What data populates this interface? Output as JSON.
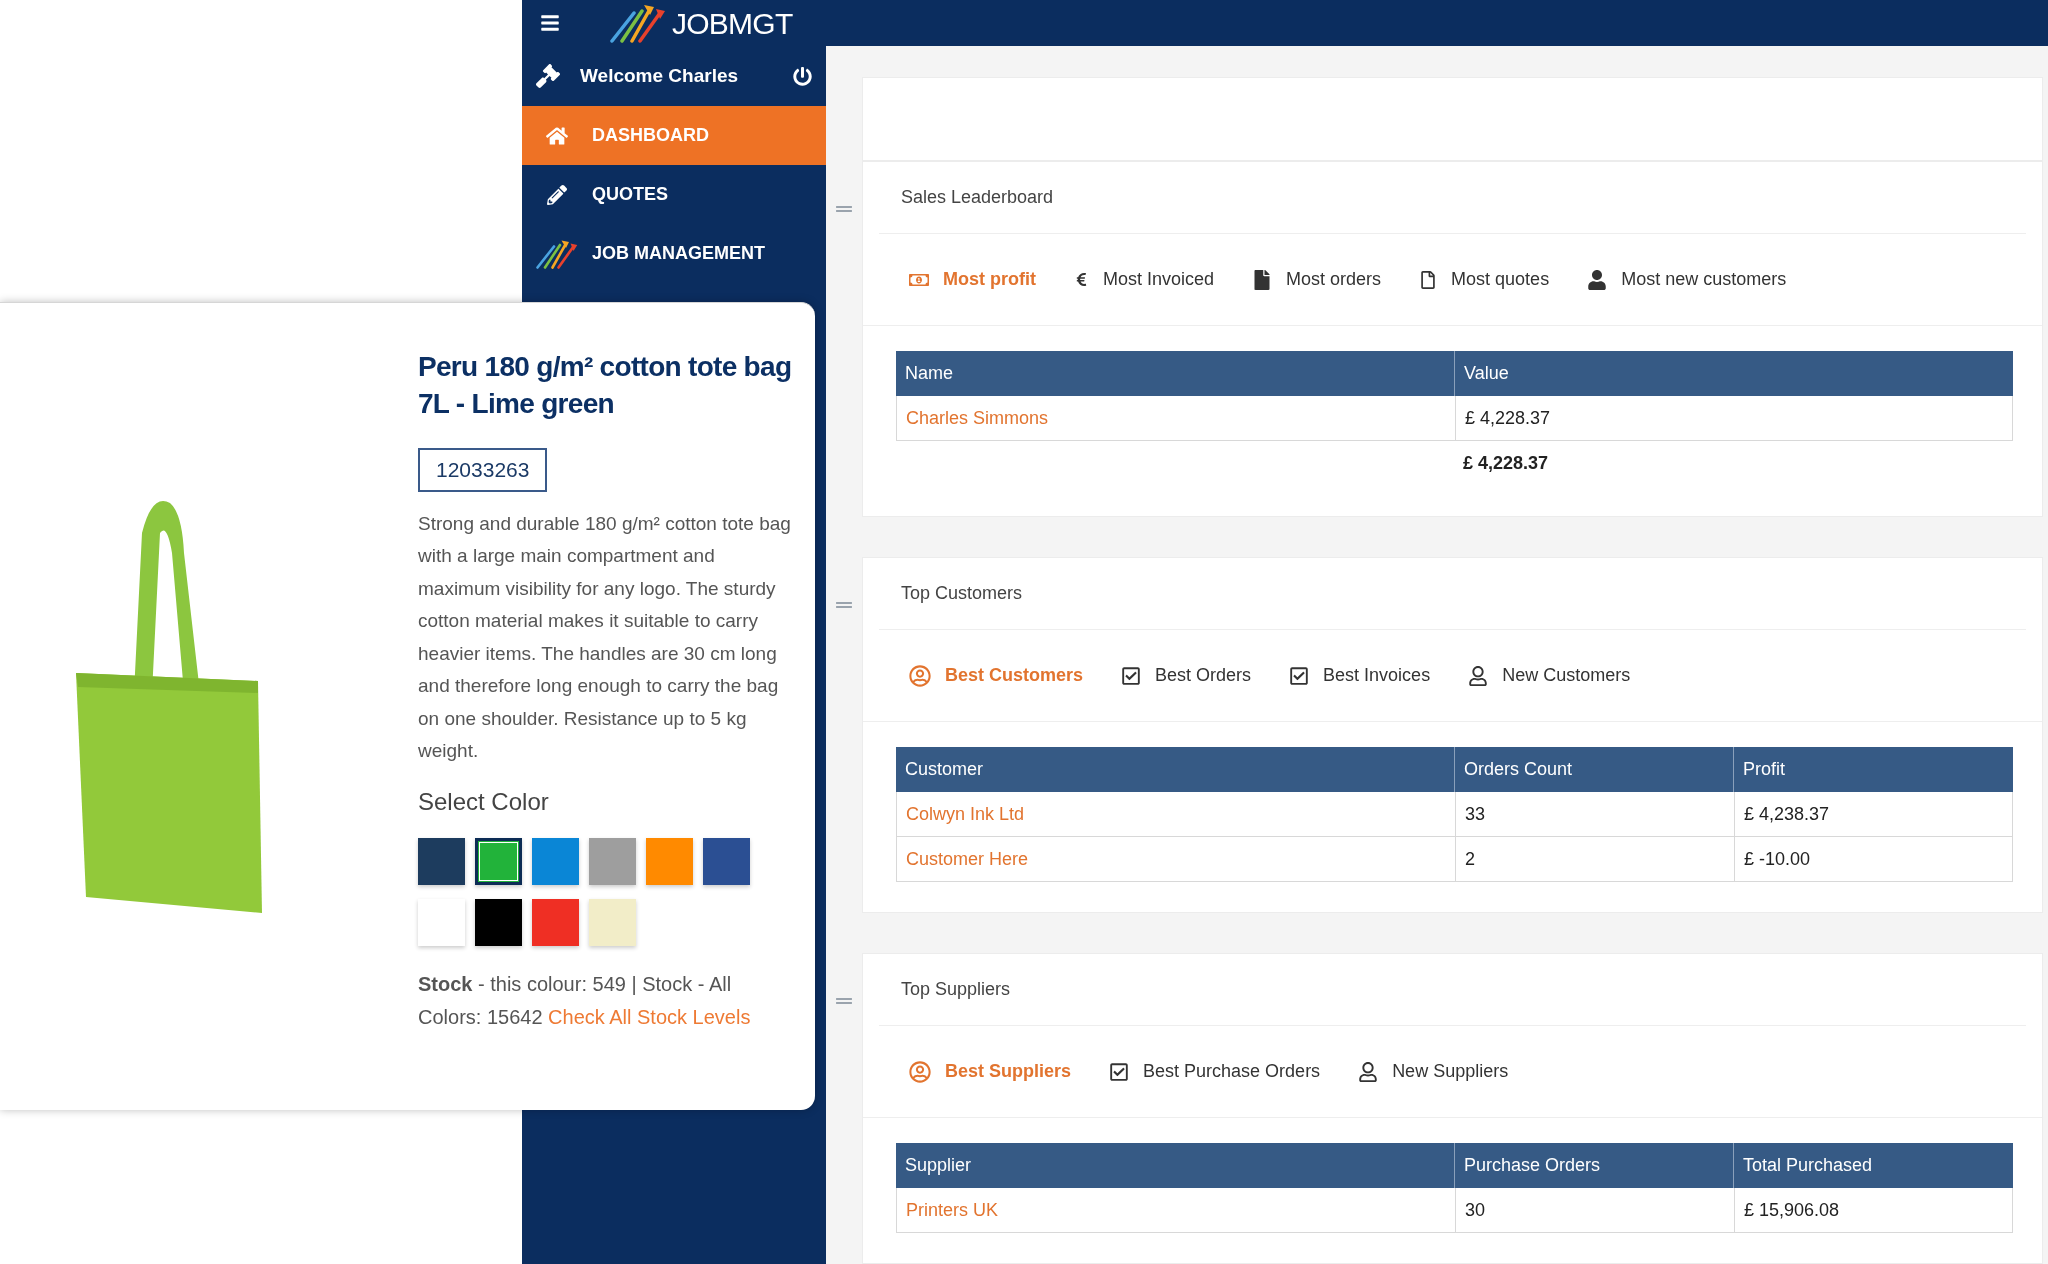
{
  "header": {
    "logo_text": "JOBMGT"
  },
  "sidebar": {
    "welcome": "Welcome Charles",
    "items": [
      {
        "label": "DASHBOARD",
        "kind": "home",
        "selected": true
      },
      {
        "label": "QUOTES",
        "kind": "pencil",
        "selected": false
      },
      {
        "label": "JOB MANAGEMENT",
        "kind": "logo",
        "selected": false
      }
    ]
  },
  "product": {
    "title": "Peru 180 g/m² cotton tote bag 7L - Lime green",
    "code": "12033263",
    "description": "Strong and durable 180 g/m² cotton tote bag with a large main compartment and maximum visibility for any logo. The sturdy cotton material makes it suitable to carry heavier items. The handles are 30 cm long and therefore long enough to carry the bag on one shoulder. Resistance up to 5 kg weight.",
    "select_color_label": "Select Color",
    "swatches": [
      {
        "color": "#1d3c5e",
        "selected": false
      },
      {
        "color": "#22b33a",
        "selected": true
      },
      {
        "color": "#0a86d6",
        "selected": false
      },
      {
        "color": "#9e9e9e",
        "selected": false
      },
      {
        "color": "#ff8a00",
        "selected": false
      },
      {
        "color": "#2b4f93",
        "selected": false
      },
      {
        "color": "#ffffff",
        "selected": false
      },
      {
        "color": "#000000",
        "selected": false
      },
      {
        "color": "#ef2f24",
        "selected": false
      },
      {
        "color": "#f2edc8",
        "selected": false
      }
    ],
    "stock_text": "**Stock** - this colour: 549 | Stock - All Colors: 15642",
    "stock_link": "Check All Stock Levels"
  },
  "panels": [
    {
      "title": "Sales Leaderboard",
      "tabs": [
        {
          "label": "Most profit",
          "kind": "money",
          "selected": true
        },
        {
          "label": "Most Invoiced",
          "kind": "euro",
          "selected": false
        },
        {
          "label": "Most orders",
          "kind": "file",
          "selected": false
        },
        {
          "label": "Most quotes",
          "kind": "file-outline",
          "selected": false
        },
        {
          "label": "Most new customers",
          "kind": "user",
          "selected": false
        }
      ],
      "table": {
        "columns": [
          "Name",
          "Value"
        ],
        "rows": [
          [
            "Charles Simmons",
            "£ 4,228.37"
          ]
        ],
        "total": "£ 4,228.37"
      }
    },
    {
      "title": "Top Customers",
      "tabs": [
        {
          "label": "Best Customers",
          "kind": "user-circle",
          "selected": true
        },
        {
          "label": "Best Orders",
          "kind": "check",
          "selected": false
        },
        {
          "label": "Best Invoices",
          "kind": "check",
          "selected": false
        },
        {
          "label": "New Customers",
          "kind": "user-outline",
          "selected": false
        }
      ],
      "table": {
        "columns": [
          "Customer",
          "Orders Count",
          "Profit"
        ],
        "rows": [
          [
            "Colwyn Ink Ltd",
            "33",
            "£ 4,238.37"
          ],
          [
            "Customer Here",
            "2",
            "£ -10.00"
          ]
        ]
      }
    },
    {
      "title": "Top Suppliers",
      "tabs": [
        {
          "label": "Best Suppliers",
          "kind": "user-circle",
          "selected": true
        },
        {
          "label": "Best Purchase Orders",
          "kind": "check",
          "selected": false
        },
        {
          "label": "New Suppliers",
          "kind": "user-outline",
          "selected": false
        }
      ],
      "table": {
        "columns": [
          "Supplier",
          "Purchase Orders",
          "Total Purchased"
        ],
        "rows": [
          [
            "Printers UK",
            "30",
            "£ 15,906.08"
          ]
        ]
      }
    }
  ]
}
